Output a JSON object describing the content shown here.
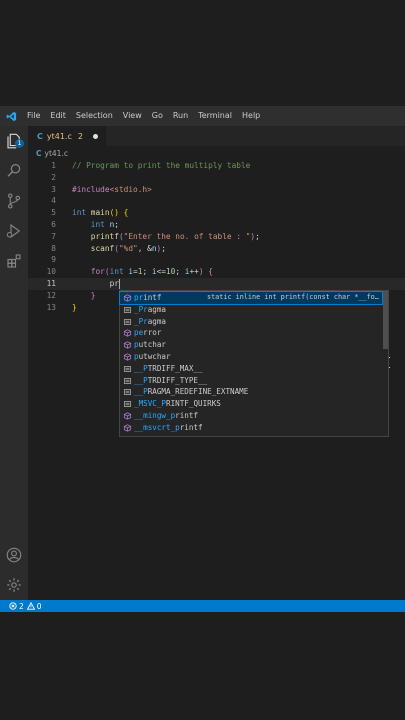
{
  "menubar": {
    "items": [
      "File",
      "Edit",
      "Selection",
      "View",
      "Go",
      "Run",
      "Terminal",
      "Help"
    ]
  },
  "activity": {
    "explorer_badge": "1"
  },
  "tab": {
    "icon_text": "C",
    "filename": "yt41.c",
    "problems": "2"
  },
  "breadcrumb": {
    "icon_text": "C",
    "filename": "yt41.c"
  },
  "editor": {
    "line_numbers": [
      "1",
      "2",
      "3",
      "4",
      "5",
      "6",
      "7",
      "8",
      "9",
      "10",
      "11",
      "12",
      "13"
    ]
  },
  "suggestions": {
    "items": [
      {
        "match": "pr",
        "rest": "intf",
        "detail": "static inline int printf(const char *__fo…",
        "icon": "cube-icon"
      },
      {
        "match": "_Pr",
        "rest": "agma",
        "detail": "",
        "icon": "keyword-icon"
      },
      {
        "match": "_Pr",
        "rest": "agma",
        "detail": "",
        "icon": "keyword-icon"
      },
      {
        "match": "pe",
        "rest": "rror",
        "detail": "",
        "icon": "cube-icon"
      },
      {
        "match": "p",
        "rest": "utchar",
        "detail": "",
        "icon": "cube-icon"
      },
      {
        "match": "p",
        "rest": "utwchar",
        "detail": "",
        "icon": "cube-icon"
      },
      {
        "match": "__P",
        "rest": "TRDIFF_MAX__",
        "detail": "",
        "icon": "keyword-icon"
      },
      {
        "match": "__P",
        "rest": "TRDIFF_TYPE__",
        "detail": "",
        "icon": "keyword-icon"
      },
      {
        "match": "__P",
        "rest": "RAGMA_REDEFINE_EXTNAME",
        "detail": "",
        "icon": "keyword-icon"
      },
      {
        "match": "_MSVC_P",
        "rest": "RINTF_QUIRKS",
        "detail": "",
        "icon": "keyword-icon"
      },
      {
        "match": "__mingw_p",
        "rest": "rintf",
        "detail": "",
        "icon": "cube-icon"
      },
      {
        "match": "__msvcrt_p",
        "rest": "rintf",
        "detail": "",
        "icon": "cube-icon"
      }
    ]
  },
  "status": {
    "errors": "2",
    "warnings": "0"
  },
  "colors": {
    "accent": "#007acc",
    "selection": "#04395e"
  }
}
